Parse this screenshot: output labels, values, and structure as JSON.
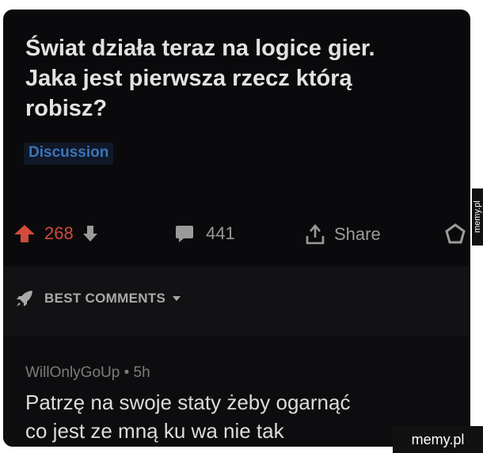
{
  "post": {
    "title": "Świat działa teraz na logice gier.\nJaka jest pierwsza rzecz którą\nrobisz?",
    "flair": "Discussion",
    "score": "268",
    "comments_count": "441",
    "share_label": "Share"
  },
  "sort": {
    "label": "BEST COMMENTS"
  },
  "comment": {
    "meta": "WillOnlyGoUp • 5h",
    "body": "Patrzę na swoje staty żeby ogarnąć\nco jest ze mną ku wa nie tak"
  },
  "watermarks": {
    "side": "memy.pl",
    "corner": "memy.pl"
  },
  "colors": {
    "background": "#0a0a0c",
    "upvote": "#d24b3a",
    "flair": "#3a74b8",
    "text": "#e2e2e2"
  }
}
